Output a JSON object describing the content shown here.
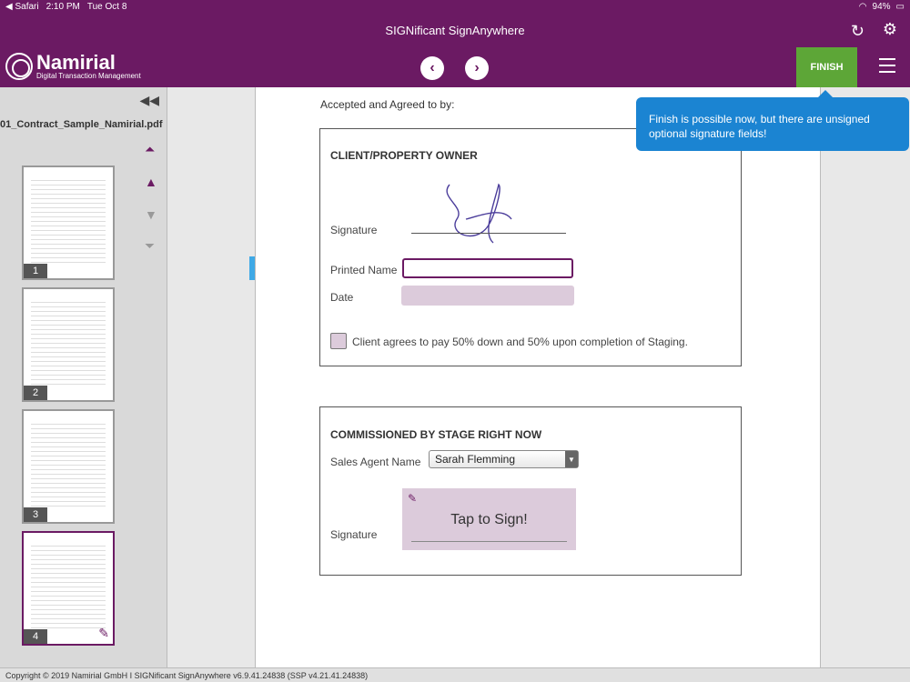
{
  "status_bar": {
    "back_app": "◀ Safari",
    "time": "2:10 PM",
    "date": "Tue Oct 8",
    "battery": "94%"
  },
  "app": {
    "title": "SIGNificant SignAnywhere"
  },
  "logo": {
    "name": "Namirial",
    "tagline": "Digital Transaction Management"
  },
  "toolbar": {
    "finish_label": "FINISH"
  },
  "tooltip": {
    "text": "Finish is possible now, but there are unsigned optional signature fields!"
  },
  "sidebar": {
    "filename": "01_Contract_Sample_Namirial.pdf",
    "pages": [
      "1",
      "2",
      "3",
      "4"
    ]
  },
  "document": {
    "accepted_text": "Accepted and Agreed to by:",
    "client_box": {
      "title": "CLIENT/PROPERTY OWNER",
      "signature_label": "Signature",
      "printed_name_label": "Printed Name",
      "date_label": "Date",
      "checkbox_text": "Client agrees to pay 50% down and 50% upon completion of Staging."
    },
    "commission_box": {
      "title": "COMMISSIONED BY STAGE RIGHT NOW",
      "agent_label": "Sales Agent Name",
      "agent_value": "Sarah Flemming",
      "signature_label": "Signature",
      "tap_to_sign": "Tap to Sign!"
    }
  },
  "footer": {
    "text": "Copyright © 2019 Namirial GmbH I SIGNificant SignAnywhere v6.9.41.24838 (SSP v4.21.41.24838)"
  }
}
